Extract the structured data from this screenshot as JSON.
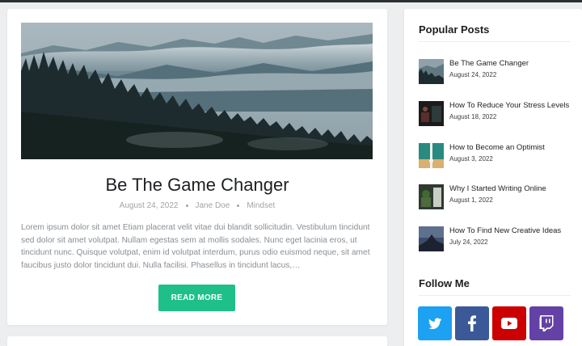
{
  "post": {
    "title": "Be The Game Changer",
    "date": "August 24, 2022",
    "author": "Jane Doe",
    "category": "Mindset",
    "excerpt": "Lorem ipsum dolor sit amet Etiam placerat velit vitae dui blandit sollicitudin. Vestibulum tincidunt sed dolor sit amet volutpat. Nullam egestas sem at mollis sodales. Nunc eget lacinia eros, ut tincidunt nunc. Quisque volutpat, enim id volutpat interdum, purus odio euismod neque, sit amet faucibus justo dolor tincidunt dui. Nulla facilisi. Phasellus in tincidunt lacus,…",
    "read_more_label": "READ MORE"
  },
  "sidebar": {
    "popular_title": "Popular Posts",
    "popular": [
      {
        "title": "Be The Game Changer",
        "date": "August 24, 2022"
      },
      {
        "title": "How To Reduce Your Stress Levels",
        "date": "August 18, 2022"
      },
      {
        "title": "How to Become an Optimist",
        "date": "August 3, 2022"
      },
      {
        "title": "Why I Started Writing Online",
        "date": "August 1, 2022"
      },
      {
        "title": "How To Find New Creative Ideas",
        "date": "July 24, 2022"
      }
    ],
    "follow_title": "Follow Me",
    "social": [
      {
        "icon": "twitter-icon",
        "color": "#1da1f2"
      },
      {
        "icon": "facebook-icon",
        "color": "#3b5998"
      },
      {
        "icon": "youtube-icon",
        "color": "#cc0000"
      },
      {
        "icon": "twitch-icon",
        "color": "#6441a5"
      }
    ]
  },
  "colors": {
    "accent": "#1fbf8a",
    "background": "#eceef0",
    "text": "#1d1f22",
    "muted": "#8a8f94"
  }
}
